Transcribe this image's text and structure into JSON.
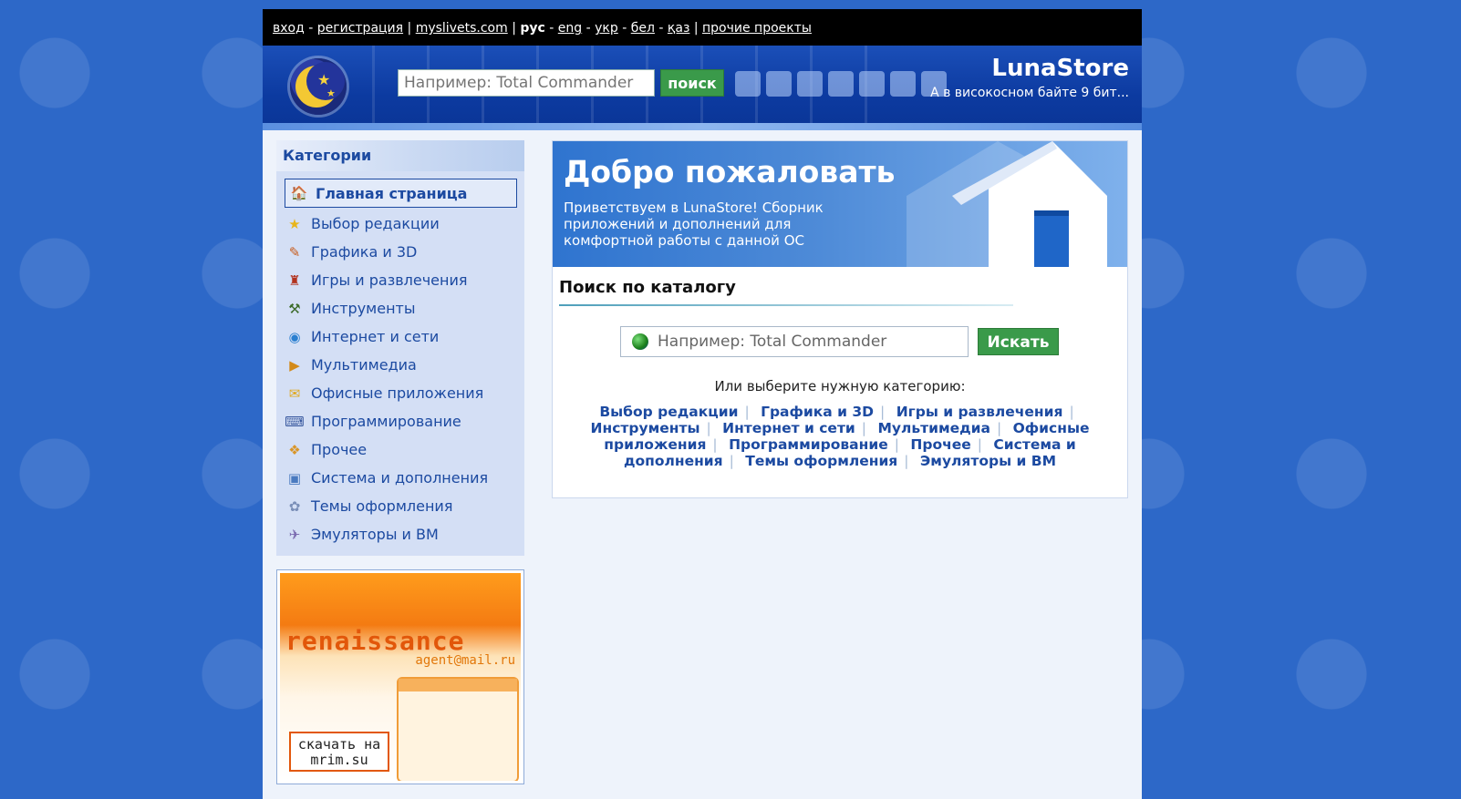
{
  "topbar": {
    "login": "вход",
    "register": "регистрация",
    "site": "myslivets.com",
    "lang_ru": "рус",
    "lang_en": "eng",
    "lang_uk": "укр",
    "lang_be": "бел",
    "lang_kz": "қаз",
    "other": "прочие проекты"
  },
  "header": {
    "search_placeholder": "Например: Total Commander",
    "search_button": "поиск",
    "brand": "LunaStore",
    "slogan": "А в високосном байте 9 бит..."
  },
  "sidebar": {
    "title": "Категории",
    "items": [
      {
        "label": "Главная страница",
        "icon": "home-icon"
      },
      {
        "label": "Выбор редакции",
        "icon": "star-icon"
      },
      {
        "label": "Графика и 3D",
        "icon": "brush-icon"
      },
      {
        "label": "Игры и развлечения",
        "icon": "games-icon"
      },
      {
        "label": "Инструменты",
        "icon": "tools-icon"
      },
      {
        "label": "Интернет и сети",
        "icon": "internet-icon"
      },
      {
        "label": "Мультимедиа",
        "icon": "media-icon"
      },
      {
        "label": "Офисные приложения",
        "icon": "office-icon"
      },
      {
        "label": "Программирование",
        "icon": "code-icon"
      },
      {
        "label": "Прочее",
        "icon": "misc-icon"
      },
      {
        "label": "Система и дополнения",
        "icon": "system-icon"
      },
      {
        "label": "Темы оформления",
        "icon": "themes-icon"
      },
      {
        "label": "Эмуляторы и ВМ",
        "icon": "emulator-icon"
      }
    ]
  },
  "ad": {
    "title": "renaissance",
    "subtitle": "agent@mail.ru",
    "button": "скачать на mrim.su"
  },
  "main": {
    "welcome_title": "Добро пожаловать",
    "welcome_text": "Приветствуем в LunaStore! Сборник приложений и дополнений для комфортной работы с данной ОС",
    "search_title": "Поиск по каталогу",
    "search_placeholder": "Например: Total Commander",
    "search_button": "Искать",
    "choose_text": "Или выберите нужную категорию:",
    "categories": [
      "Выбор редакции",
      "Графика и 3D",
      "Игры и развлечения",
      "Инструменты",
      "Интернет и сети",
      "Мультимедиа",
      "Офисные приложения",
      "Программирование",
      "Прочее",
      "Система и дополнения",
      "Темы оформления",
      "Эмуляторы и ВМ"
    ]
  },
  "colors": {
    "background": "#2d68c8",
    "link": "#1c4aa1",
    "button": "#3a9a4a"
  }
}
